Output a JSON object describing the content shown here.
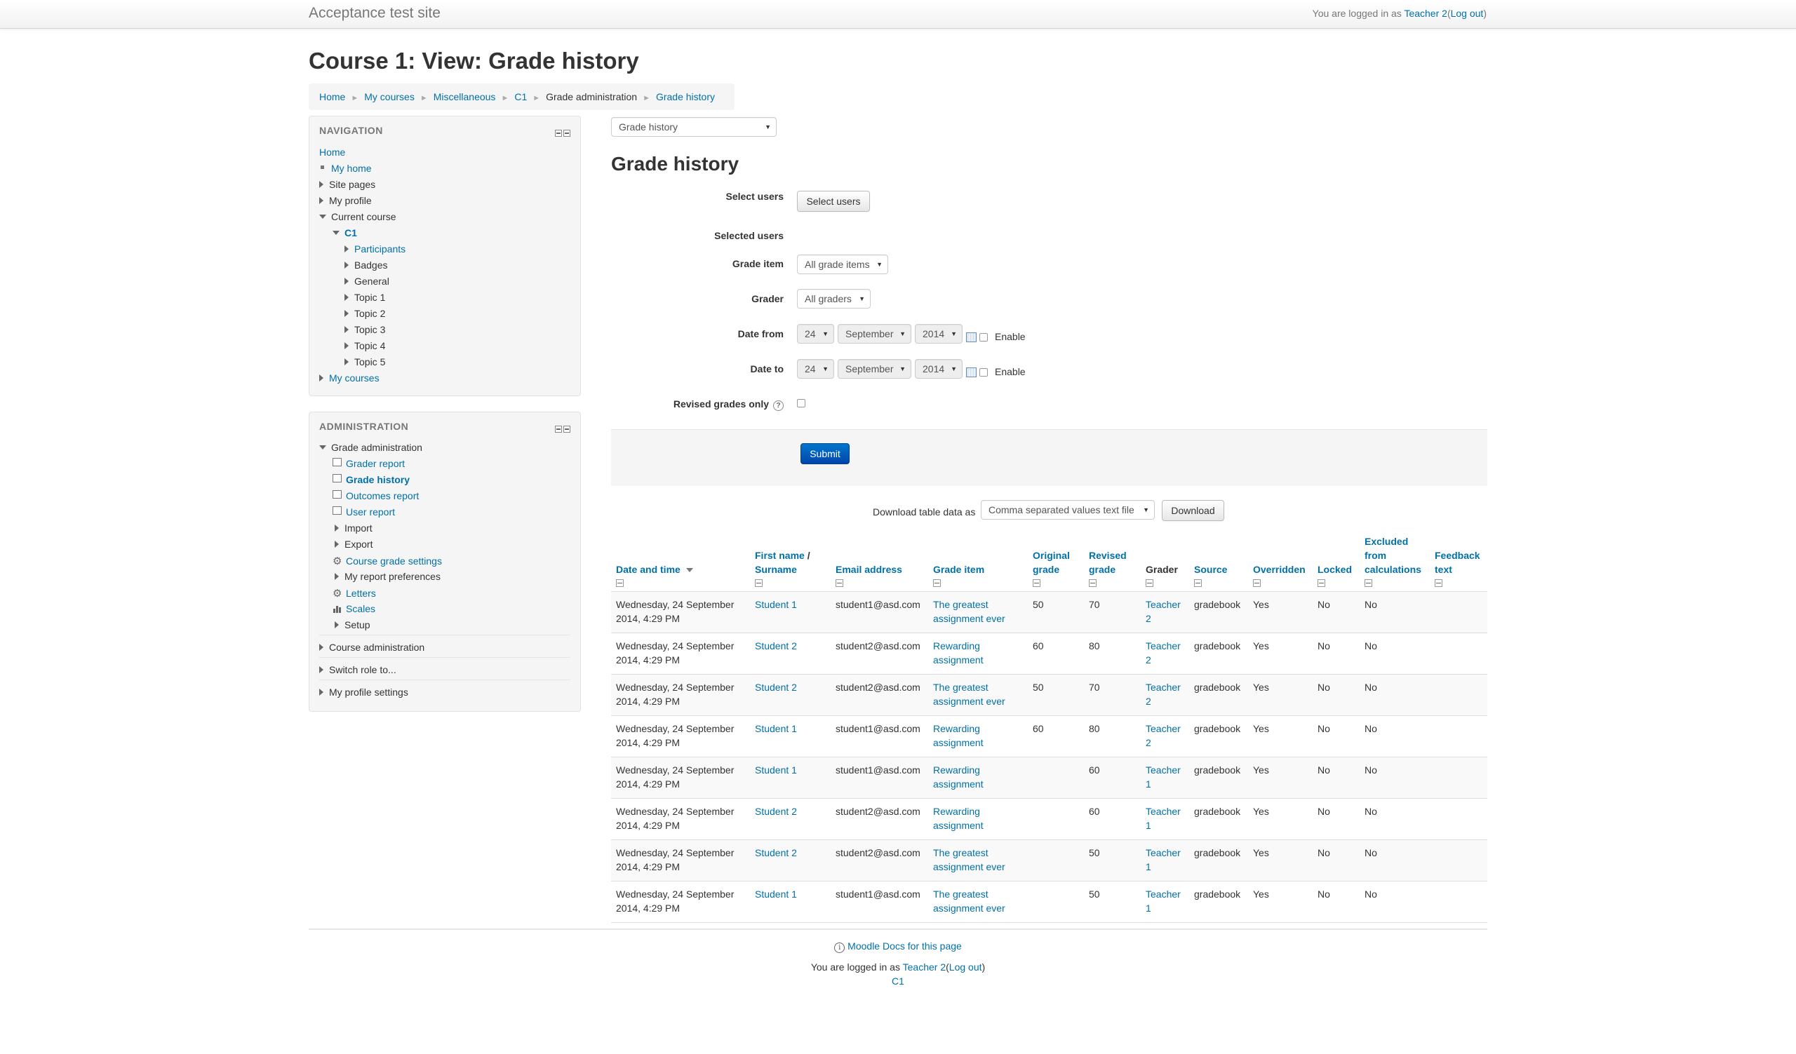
{
  "header": {
    "site_name": "Acceptance test site",
    "login_prefix": "You are logged in as",
    "user": "Teacher 2",
    "logout": "Log out"
  },
  "page_title": "Course 1: View: Grade history",
  "breadcrumb": [
    "Home",
    "My courses",
    "Miscellaneous",
    "C1",
    "Grade administration",
    "Grade history"
  ],
  "navigation": {
    "title": "NAVIGATION",
    "home": "Home",
    "my_home": "My home",
    "site_pages": "Site pages",
    "my_profile": "My profile",
    "current_course": "Current course",
    "course": "C1",
    "participants": "Participants",
    "badges": "Badges",
    "general": "General",
    "topic1": "Topic 1",
    "topic2": "Topic 2",
    "topic3": "Topic 3",
    "topic4": "Topic 4",
    "topic5": "Topic 5",
    "my_courses": "My courses"
  },
  "administration": {
    "title": "ADMINISTRATION",
    "grade_admin": "Grade administration",
    "grader_report": "Grader report",
    "grade_history": "Grade history",
    "outcomes_report": "Outcomes report",
    "user_report": "User report",
    "import": "Import",
    "export": "Export",
    "course_grade_settings": "Course grade settings",
    "my_report_preferences": "My report preferences",
    "letters": "Letters",
    "scales": "Scales",
    "setup": "Setup",
    "course_admin": "Course administration",
    "switch_role": "Switch role to...",
    "my_profile_settings": "My profile settings"
  },
  "report_select": "Grade history",
  "heading": "Grade history",
  "form": {
    "select_users_label": "Select users",
    "select_users_button": "Select users",
    "selected_users_label": "Selected users",
    "grade_item_label": "Grade item",
    "grade_item_value": "All grade items",
    "grader_label": "Grader",
    "grader_value": "All graders",
    "date_from_label": "Date from",
    "date_to_label": "Date to",
    "day": "24",
    "month": "September",
    "year": "2014",
    "enable": "Enable",
    "revised_label": "Revised grades only",
    "submit": "Submit"
  },
  "download": {
    "label": "Download table data as",
    "format": "Comma separated values text file",
    "button": "Download"
  },
  "table": {
    "headers": {
      "date": "Date and time",
      "first_name": "First name",
      "surname": "Surname",
      "email": "Email address",
      "grade_item": "Grade item",
      "original": "Original grade",
      "revised": "Revised grade",
      "grader": "Grader",
      "source": "Source",
      "overridden": "Overridden",
      "locked": "Locked",
      "excluded": "Excluded from calculations",
      "feedback": "Feedback text"
    },
    "rows": [
      {
        "date": "Wednesday, 24 September 2014, 4:29 PM",
        "name": "Student 1",
        "email": "student1@asd.com",
        "item": "The greatest assignment ever",
        "original": "50",
        "revised": "70",
        "grader": "Teacher 2",
        "source": "gradebook",
        "overridden": "Yes",
        "locked": "No",
        "excluded": "No",
        "feedback": ""
      },
      {
        "date": "Wednesday, 24 September 2014, 4:29 PM",
        "name": "Student 2",
        "email": "student2@asd.com",
        "item": "Rewarding assignment",
        "original": "60",
        "revised": "80",
        "grader": "Teacher 2",
        "source": "gradebook",
        "overridden": "Yes",
        "locked": "No",
        "excluded": "No",
        "feedback": ""
      },
      {
        "date": "Wednesday, 24 September 2014, 4:29 PM",
        "name": "Student 2",
        "email": "student2@asd.com",
        "item": "The greatest assignment ever",
        "original": "50",
        "revised": "70",
        "grader": "Teacher 2",
        "source": "gradebook",
        "overridden": "Yes",
        "locked": "No",
        "excluded": "No",
        "feedback": ""
      },
      {
        "date": "Wednesday, 24 September 2014, 4:29 PM",
        "name": "Student 1",
        "email": "student1@asd.com",
        "item": "Rewarding assignment",
        "original": "60",
        "revised": "80",
        "grader": "Teacher 2",
        "source": "gradebook",
        "overridden": "Yes",
        "locked": "No",
        "excluded": "No",
        "feedback": ""
      },
      {
        "date": "Wednesday, 24 September 2014, 4:29 PM",
        "name": "Student 1",
        "email": "student1@asd.com",
        "item": "Rewarding assignment",
        "original": "",
        "revised": "60",
        "grader": "Teacher 1",
        "source": "gradebook",
        "overridden": "Yes",
        "locked": "No",
        "excluded": "No",
        "feedback": ""
      },
      {
        "date": "Wednesday, 24 September 2014, 4:29 PM",
        "name": "Student 2",
        "email": "student2@asd.com",
        "item": "Rewarding assignment",
        "original": "",
        "revised": "60",
        "grader": "Teacher 1",
        "source": "gradebook",
        "overridden": "Yes",
        "locked": "No",
        "excluded": "No",
        "feedback": ""
      },
      {
        "date": "Wednesday, 24 September 2014, 4:29 PM",
        "name": "Student 2",
        "email": "student2@asd.com",
        "item": "The greatest assignment ever",
        "original": "",
        "revised": "50",
        "grader": "Teacher 1",
        "source": "gradebook",
        "overridden": "Yes",
        "locked": "No",
        "excluded": "No",
        "feedback": ""
      },
      {
        "date": "Wednesday, 24 September 2014, 4:29 PM",
        "name": "Student 1",
        "email": "student1@asd.com",
        "item": "The greatest assignment ever",
        "original": "",
        "revised": "50",
        "grader": "Teacher 1",
        "source": "gradebook",
        "overridden": "Yes",
        "locked": "No",
        "excluded": "No",
        "feedback": ""
      }
    ]
  },
  "footer": {
    "docs": "Moodle Docs for this page",
    "login_prefix": "You are logged in as",
    "user": "Teacher 2",
    "logout": "Log out",
    "course": "C1"
  }
}
